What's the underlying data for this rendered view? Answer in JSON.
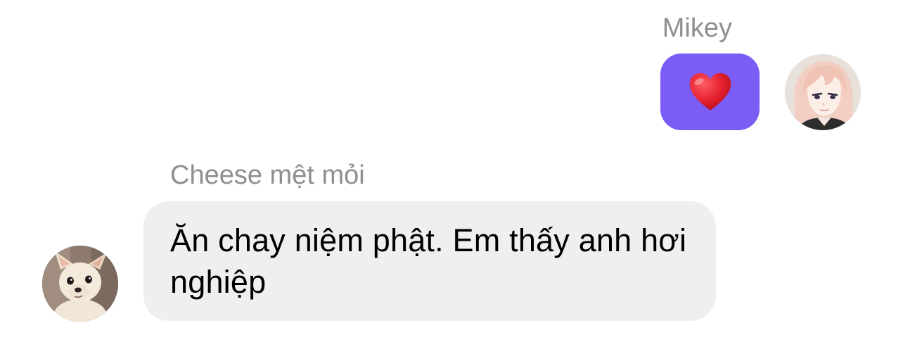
{
  "messages": [
    {
      "sender": "Mikey",
      "direction": "outgoing",
      "content": "❤️",
      "bubble_color": "#7b5cf5",
      "avatar": "anime-character-avatar"
    },
    {
      "sender": "Cheese mệt mỏi",
      "direction": "incoming",
      "content": "Ăn chay niệm phật. Em thấy anh hơi nghiệp",
      "bubble_color": "#efeff0",
      "avatar": "chihuahua-dog-avatar"
    }
  ],
  "colors": {
    "sender_name": "#8e8e93",
    "heart": "#e0202e"
  }
}
